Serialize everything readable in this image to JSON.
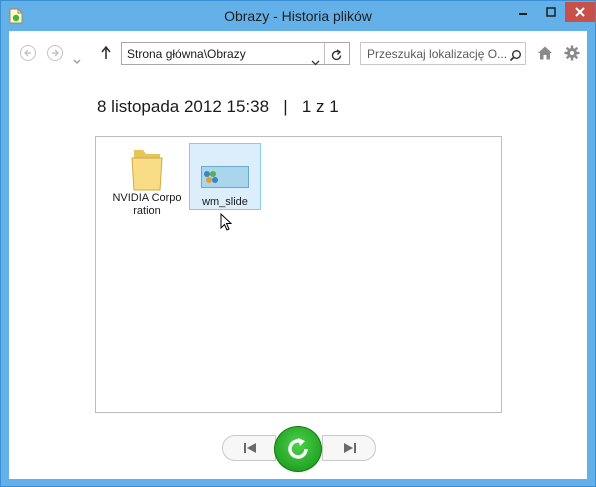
{
  "window": {
    "title": "Obrazy - Historia plików"
  },
  "toolbar": {
    "address": "Strona główna\\Obrazy",
    "search_placeholder": "Przeszukaj lokalizację O..."
  },
  "header": {
    "date": "8 listopada 2012 15:38",
    "separator": "|",
    "page": "1 z 1"
  },
  "items": [
    {
      "label": "NVIDIA Corporation",
      "icon": "folder-icon"
    },
    {
      "label": "wm_slide",
      "icon": "image-file-icon"
    }
  ],
  "colors": {
    "accent": "#6fb6ea",
    "close": "#c7504b",
    "restore": "#1fae1f"
  }
}
